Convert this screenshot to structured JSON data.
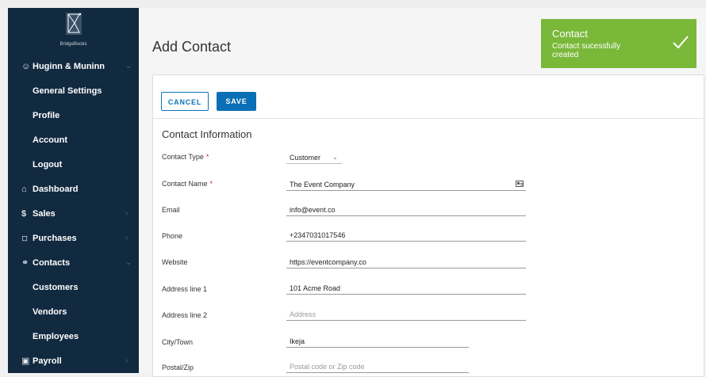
{
  "brand": {
    "name": "BridgeBooks"
  },
  "sidebar": {
    "org": {
      "label": "Huginn & Muninn",
      "icon": "user-icon"
    },
    "org_sub": [
      {
        "label": "General Settings"
      },
      {
        "label": "Profile"
      },
      {
        "label": "Account"
      },
      {
        "label": "Logout"
      }
    ],
    "items": [
      {
        "label": "Dashboard",
        "icon": "home-icon"
      },
      {
        "label": "Sales",
        "icon": "dollar-icon"
      },
      {
        "label": "Purchases",
        "icon": "cart-icon"
      },
      {
        "label": "Contacts",
        "icon": "contacts-icon"
      }
    ],
    "contacts_sub": [
      {
        "label": "Customers"
      },
      {
        "label": "Vendors"
      },
      {
        "label": "Employees"
      }
    ],
    "payroll": {
      "label": "Payroll",
      "icon": "payroll-icon"
    }
  },
  "page": {
    "title": "Add Contact"
  },
  "actions": {
    "cancel": "CANCEL",
    "save": "SAVE"
  },
  "form": {
    "section_title": "Contact Information",
    "fields": [
      {
        "label": "Contact Type",
        "required": true,
        "value": "Customer",
        "placeholder": ""
      },
      {
        "label": "Contact Name",
        "required": true,
        "value": "The Event Company",
        "placeholder": ""
      },
      {
        "label": "Email",
        "required": false,
        "value": "info@event.co",
        "placeholder": ""
      },
      {
        "label": "Phone",
        "required": false,
        "value": "+2347031017546",
        "placeholder": ""
      },
      {
        "label": "Website",
        "required": false,
        "value": "https://eventcompany.co",
        "placeholder": ""
      },
      {
        "label": "Address line 1",
        "required": false,
        "value": "101 Acme Road",
        "placeholder": ""
      },
      {
        "label": "Address line 2",
        "required": false,
        "value": "",
        "placeholder": "Address"
      },
      {
        "label": "City/Town",
        "required": false,
        "value": "Ikeja",
        "placeholder": ""
      },
      {
        "label": "Postal/Zip",
        "required": false,
        "value": "",
        "placeholder": "Postal code or Zip code"
      }
    ],
    "required_mark": "*"
  },
  "toast": {
    "title": "Contact",
    "message": "Contact sucessfully created",
    "color": "#7ab83a"
  },
  "colors": {
    "sidebar": "#122a40",
    "primary": "#0a6fb5",
    "required": "#d02323"
  }
}
